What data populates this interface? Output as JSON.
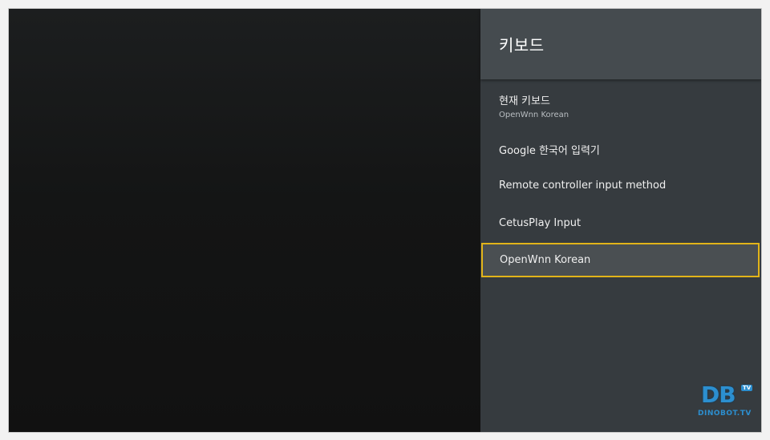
{
  "panel": {
    "title": "키보드"
  },
  "menu": {
    "current_keyboard": {
      "label": "현재 키보드",
      "value": "OpenWnn Korean"
    },
    "items": [
      {
        "label": "Google 한국어 입력기"
      },
      {
        "label": "Remote controller input method"
      },
      {
        "label": "CetusPlay Input"
      },
      {
        "label": "OpenWnn Korean",
        "focused": true
      }
    ]
  },
  "watermark": {
    "logo": "DB",
    "badge": "TV",
    "text": "DINOBOT.TV"
  },
  "colors": {
    "panel_bg": "#363b3f",
    "header_bg": "#454b4f",
    "focus_border": "#e2b419"
  }
}
